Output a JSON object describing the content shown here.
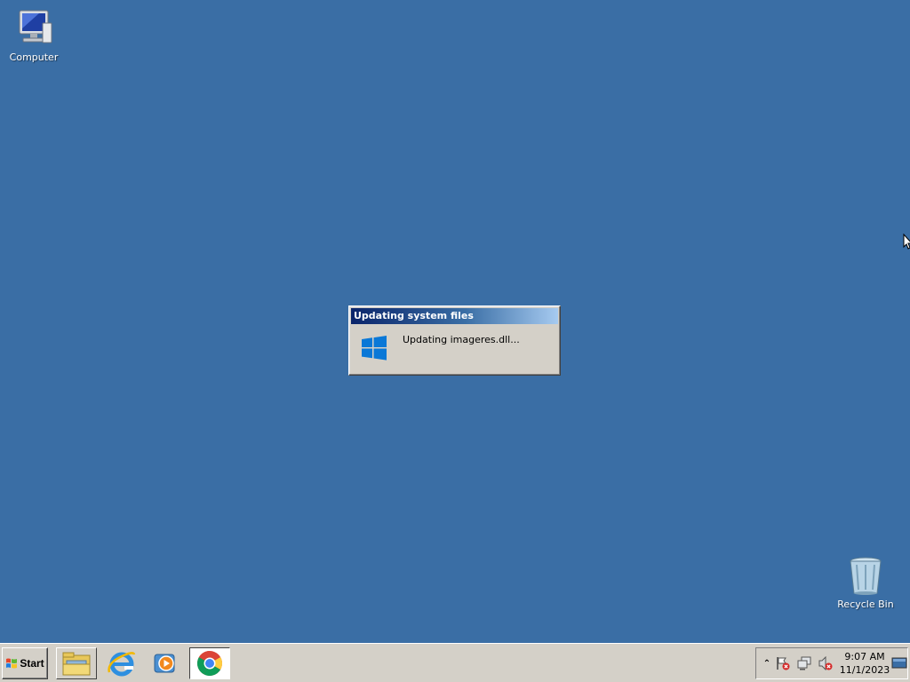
{
  "desktop": {
    "background": "#3a6ea5",
    "icons": [
      {
        "label": "Computer",
        "icon": "computer-icon"
      },
      {
        "label": "Recycle Bin",
        "icon": "recycle-bin-icon"
      }
    ]
  },
  "dialog": {
    "title": "Updating system files",
    "message": "Updating imageres.dll...",
    "icon": "windows-logo-icon"
  },
  "taskbar": {
    "start_label": "Start",
    "pinned": [
      {
        "name": "explorer",
        "icon": "folder-icon"
      },
      {
        "name": "internet-explorer",
        "icon": "ie-icon"
      },
      {
        "name": "media-player",
        "icon": "media-player-icon"
      },
      {
        "name": "chrome",
        "icon": "chrome-icon",
        "active": true
      }
    ],
    "tray": {
      "expand_glyph": "⌃",
      "icons": [
        "action-center-flag-icon",
        "network-icon",
        "volume-muted-icon",
        "show-desktop-icon"
      ],
      "time": "9:07 AM",
      "date": "11/1/2023"
    }
  }
}
